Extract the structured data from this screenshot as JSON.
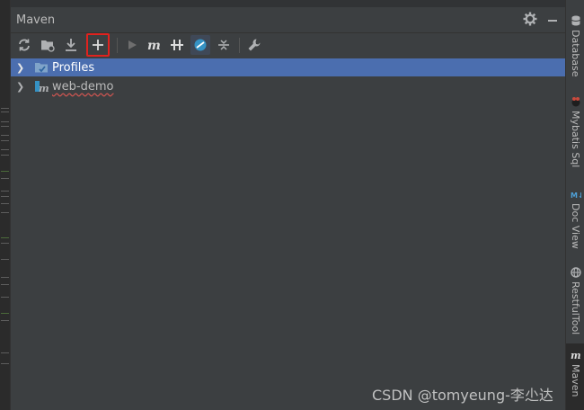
{
  "window": {
    "title": "Maven"
  },
  "tree": {
    "items": [
      {
        "label": "Profiles",
        "selected": true,
        "icon": "profiles-folder-icon"
      },
      {
        "label": "web-demo",
        "selected": false,
        "icon": "maven-module-icon"
      }
    ]
  },
  "right_strip": {
    "tabs": [
      {
        "label": "Database",
        "icon": "database-icon"
      },
      {
        "label": "Mybatis Sql",
        "icon": "mybatis-icon"
      },
      {
        "label": "Doc View",
        "icon": "doc-view-icon"
      },
      {
        "label": "RestfulTool",
        "icon": "globe-icon"
      },
      {
        "label": "Maven",
        "icon": "maven-icon",
        "active": true
      }
    ]
  },
  "watermark": "CSDN @tomyeung-李尐达",
  "colors": {
    "selection": "#4b6eaf",
    "highlight_box": "#e0221e",
    "background": "#3c3f41"
  }
}
